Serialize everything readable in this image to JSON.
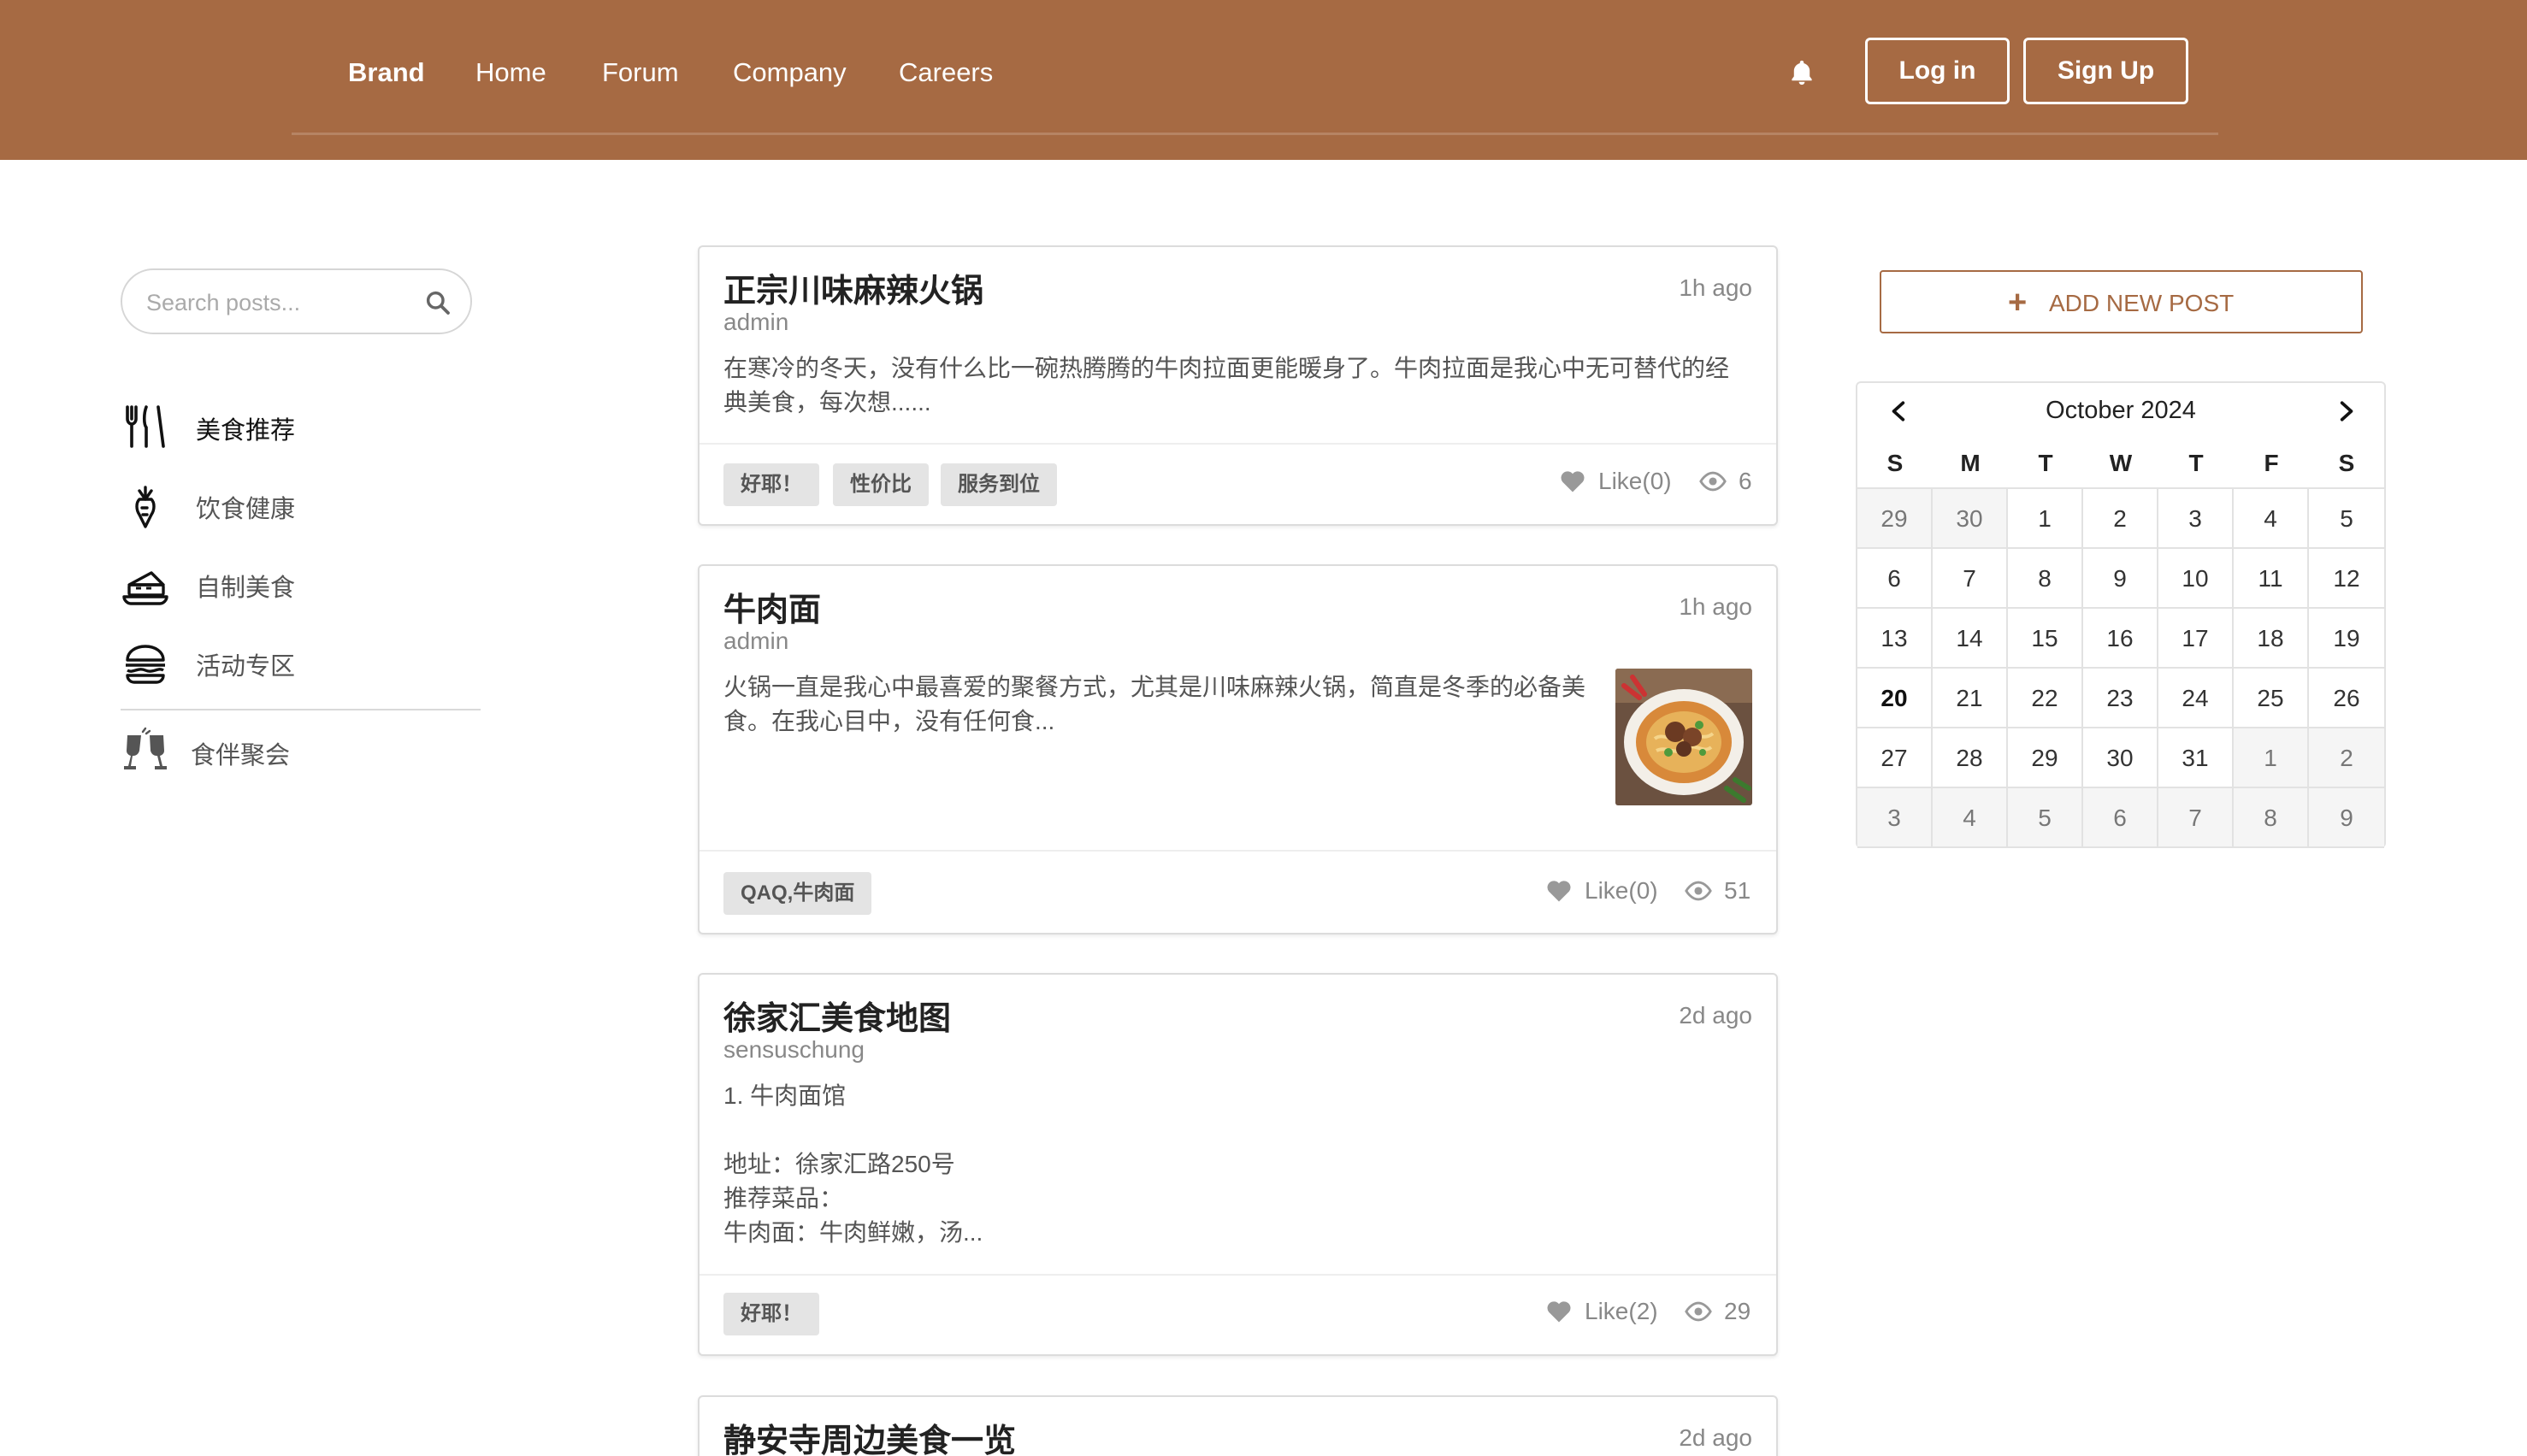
{
  "nav": {
    "brand": "Brand",
    "links": [
      "Home",
      "Forum",
      "Company",
      "Careers"
    ],
    "login": "Log in",
    "signup": "Sign Up"
  },
  "search": {
    "placeholder": "Search posts..."
  },
  "sidebar": {
    "items": [
      {
        "label": "美食推荐",
        "icon": "fork-knife-icon"
      },
      {
        "label": "饮食健康",
        "icon": "carrot-icon"
      },
      {
        "label": "自制美食",
        "icon": "cake-icon"
      },
      {
        "label": "活动专区",
        "icon": "burger-icon"
      }
    ],
    "extra": {
      "label": "食伴聚会",
      "icon": "cheers-icon"
    }
  },
  "posts": [
    {
      "title": "正宗川味麻辣火锅",
      "time": "1h ago",
      "author": "admin",
      "excerpt": "在寒冷的冬天，没有什么比一碗热腾腾的牛肉拉面更能暖身了。牛肉拉面是我心中无可替代的经典美食，每次想......",
      "tags": [
        "好耶！",
        "性价比",
        "服务到位"
      ],
      "likes": "Like(0)",
      "views": "6"
    },
    {
      "title": "牛肉面",
      "time": "1h ago",
      "author": "admin",
      "excerpt": "火锅一直是我心中最喜爱的聚餐方式，尤其是川味麻辣火锅，简直是冬季的必备美食。在我心目中，没有任何食...",
      "tags": [
        "QAQ,牛肉面"
      ],
      "likes": "Like(0)",
      "views": "51"
    },
    {
      "title": "徐家汇美食地图",
      "time": "2d ago",
      "author": "sensuschung",
      "lines": [
        "1. 牛肉面馆",
        "",
        "地址：徐家汇路250号",
        "推荐菜品：",
        "牛肉面：牛肉鲜嫩，汤..."
      ],
      "tags": [
        "好耶！"
      ],
      "likes": "Like(2)",
      "views": "29"
    },
    {
      "title": "静安寺周边美食一览",
      "time": "2d ago"
    }
  ],
  "add_post": {
    "label": "ADD NEW POST"
  },
  "calendar": {
    "month": "October 2024",
    "weekdays": [
      "S",
      "M",
      "T",
      "W",
      "T",
      "F",
      "S"
    ],
    "weeks": [
      [
        "29",
        "30",
        "1",
        "2",
        "3",
        "4",
        "5"
      ],
      [
        "6",
        "7",
        "8",
        "9",
        "10",
        "11",
        "12"
      ],
      [
        "13",
        "14",
        "15",
        "16",
        "17",
        "18",
        "19"
      ],
      [
        "20",
        "21",
        "22",
        "23",
        "24",
        "25",
        "26"
      ],
      [
        "27",
        "28",
        "29",
        "30",
        "31",
        "1",
        "2"
      ],
      [
        "3",
        "4",
        "5",
        "6",
        "7",
        "8",
        "9"
      ]
    ],
    "today": "20"
  },
  "colors": {
    "brand": "#a66a43",
    "tag_bg": "#e4e4e4",
    "muted_cell": "#f5f5f5"
  }
}
